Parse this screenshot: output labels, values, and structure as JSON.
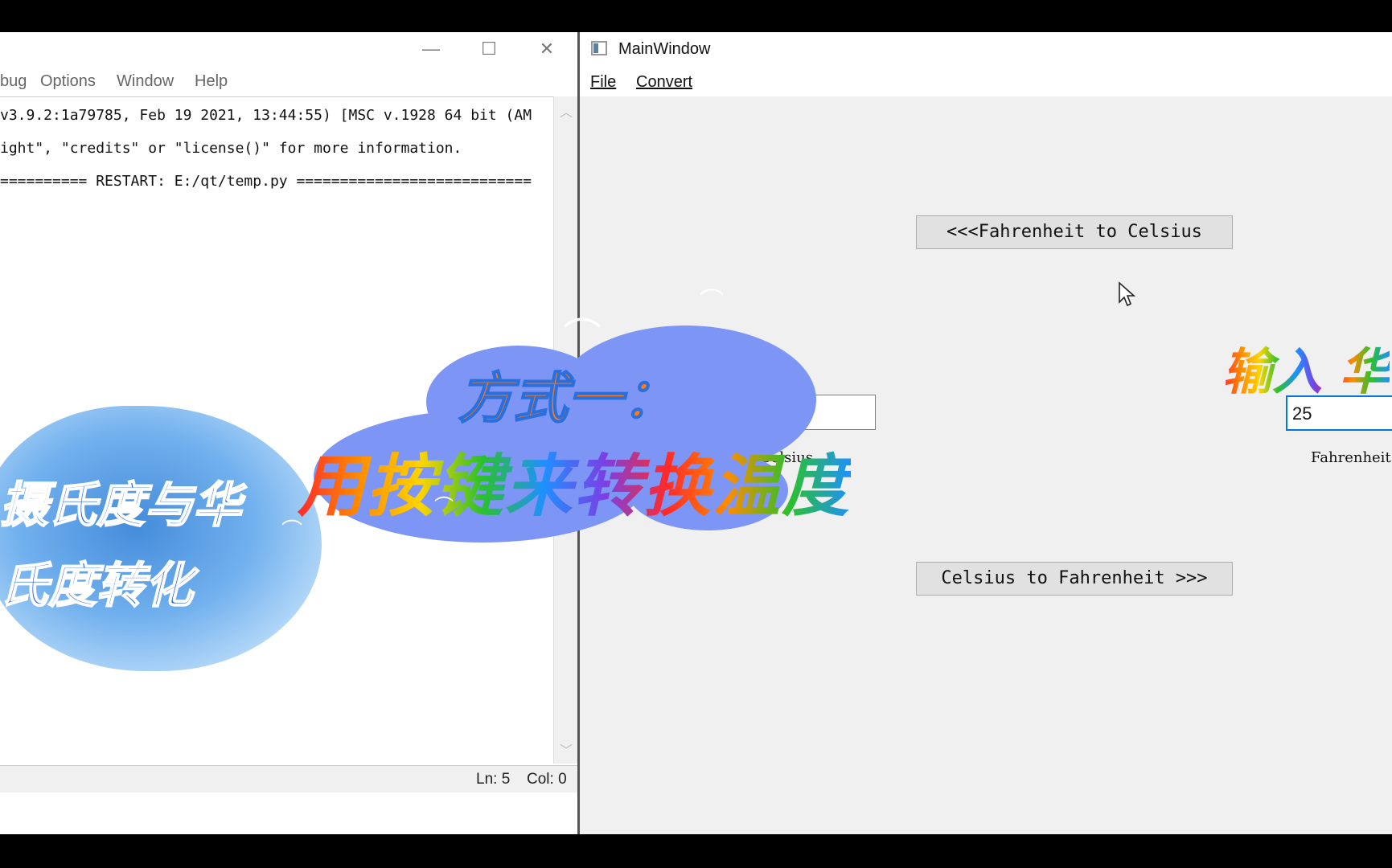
{
  "idle": {
    "menu": [
      "bug",
      "Options",
      "Window",
      "Help"
    ],
    "shell_lines": [
      "v3.9.2:1a79785, Feb 19 2021, 13:44:55) [MSC v.1928 64 bit (AM",
      "ight\", \"credits\" or \"license()\" for more information.",
      "========== RESTART: E:/qt/temp.py ==========================="
    ],
    "status": {
      "line": "Ln: 5",
      "col": "Col: 0"
    },
    "window_controls": {
      "minimize": "—",
      "maximize": "☐",
      "close": "✕"
    }
  },
  "qt": {
    "title": "MainWindow",
    "menu": {
      "file": "File",
      "convert": "Convert"
    },
    "f2c_button": "<<<Fahrenheit to Celsius",
    "c2f_button": "Celsius to Fahrenheit >>>",
    "celsius_value": "",
    "celsius_label": "Celsius",
    "fahrenheit_value": "25",
    "fahrenheit_label": "Fahrenheit"
  },
  "overlay": {
    "headline_1": "方式一：",
    "headline_2": "用按键来转换温度",
    "left_text_1": "摄氏度与华",
    "left_text_2": "氏度转化",
    "right_text": "输入 华"
  }
}
